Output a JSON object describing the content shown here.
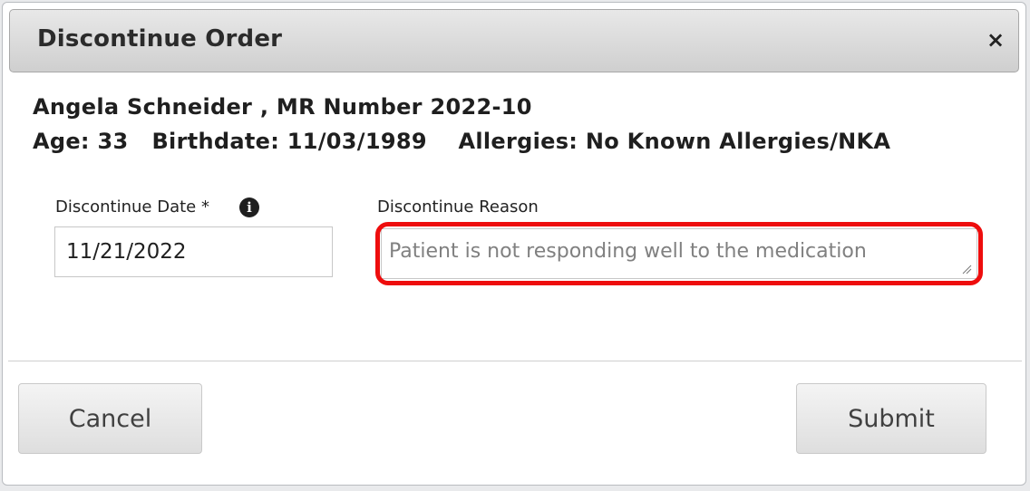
{
  "dialog": {
    "title": "Discontinue Order",
    "close_glyph": "×"
  },
  "patient": {
    "line1": "Angela Schneider , MR Number 2022-10",
    "line2": "Age: 33   Birthdate: 11/03/1989    Allergies: No Known Allergies/NKA"
  },
  "form": {
    "date_label": "Discontinue Date *",
    "date_value": "11/21/2022",
    "reason_label": "Discontinue Reason",
    "reason_placeholder": "Patient is not responding well to the medication"
  },
  "icons": {
    "info": "info-icon",
    "info_glyph": "i",
    "close": "close-icon",
    "resize": "resize-grip-icon"
  },
  "footer": {
    "cancel_label": "Cancel",
    "submit_label": "Submit"
  },
  "colors": {
    "highlight": "#ee0d0d",
    "header_bg": "#d9d9d9"
  }
}
